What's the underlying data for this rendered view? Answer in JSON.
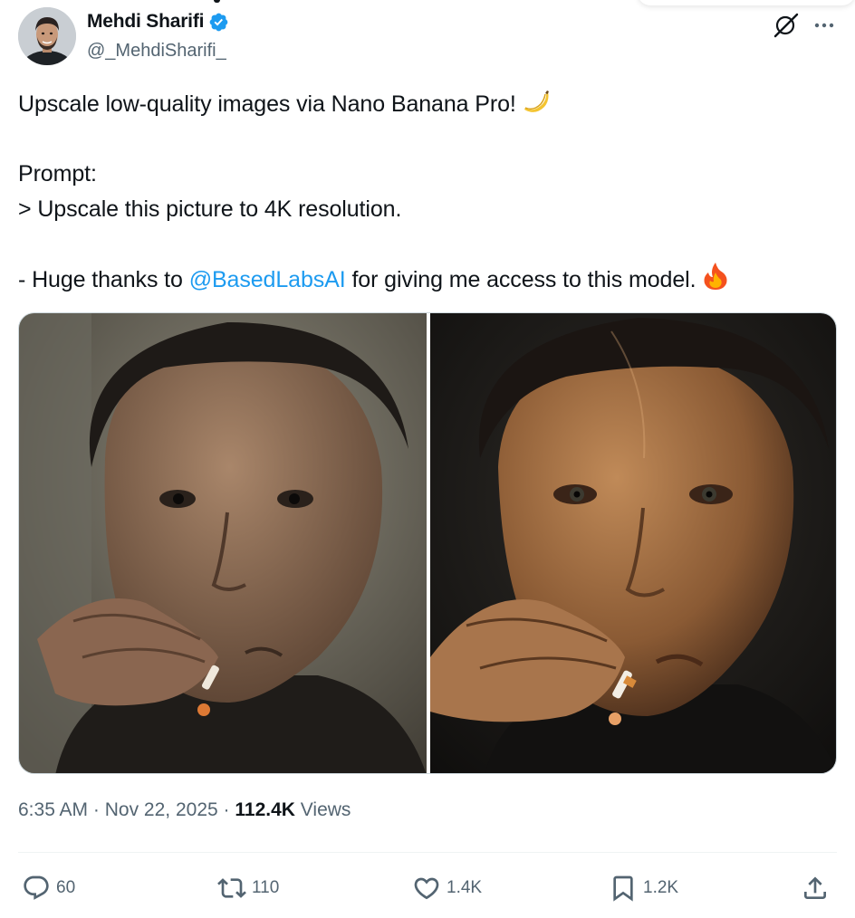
{
  "author": {
    "display_name": "Mehdi Sharifi",
    "handle": "@_MehdiSharifi_",
    "verified": true
  },
  "icons": {
    "verified": "verified-badge-icon",
    "grok": "grok-icon",
    "more": "more-icon",
    "reply": "reply-icon",
    "repost": "repost-icon",
    "like": "like-icon",
    "bookmark": "bookmark-icon",
    "share": "share-icon"
  },
  "tweet": {
    "line1": "Upscale low-quality images via Nano Banana Pro!",
    "line1_emoji": "banana",
    "prompt_label": "Prompt:",
    "prompt_text": "> Upscale this picture to 4K resolution.",
    "thanks_prefix": "- Huge thanks to ",
    "mention": "@BasedLabsAI",
    "thanks_suffix": " for giving me access to this model.",
    "thanks_emoji": "fire"
  },
  "meta": {
    "time": "6:35 AM",
    "separator": "·",
    "date": "Nov 22, 2025",
    "views_count": "112.4K",
    "views_label": "Views"
  },
  "actions": {
    "replies": "60",
    "reposts": "110",
    "likes": "1.4K",
    "bookmarks": "1.2K"
  },
  "colors": {
    "accent": "#1d9bf0",
    "text_primary": "#0f1419",
    "text_secondary": "#536471",
    "divider": "#eff3f4"
  }
}
